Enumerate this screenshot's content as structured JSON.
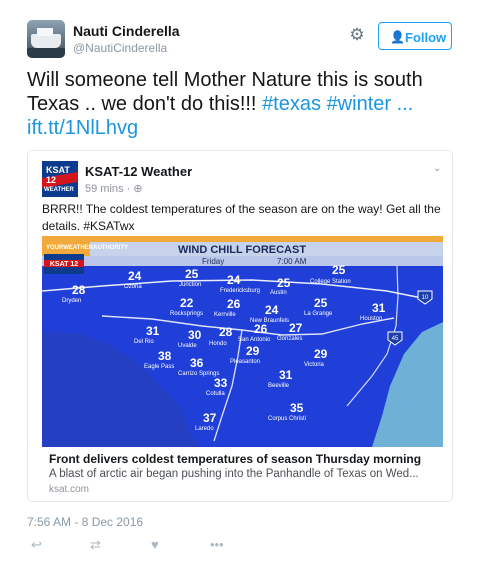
{
  "user": {
    "display_name": "Nauti Cinderella",
    "handle": "@NautiCinderella",
    "follow_label": "Follow"
  },
  "tweet": {
    "text_part1": "Will someone tell Mother Nature this is south Texas .. we don't do this!!! ",
    "hashtag1": "#texas",
    "hashtag2": "#winter",
    "ellipsis": " ...",
    "link": "ift.tt/1NlLhvg",
    "timestamp": "7:56 AM - 8 Dec 2016"
  },
  "card": {
    "source_name": "KSAT-12 Weather",
    "source_time": "59 mins · ",
    "logo_top": "KSAT 12",
    "logo_bottom": "WEATHER",
    "post_text": "BRRR!! The coldest temperatures of the season are on the way! Get all the details.  #KSATwx",
    "link_title": "Front delivers coldest temperatures of season Thursday morning",
    "link_desc": "A blast of arctic air began pushing into the Panhandle of Texas on Wed...",
    "link_domain": "ksat.com"
  },
  "map": {
    "brand": "YOURWEATHERAUTHORITY",
    "title": "WIND CHILL FORECAST",
    "day": "Friday",
    "time": "7:00 AM",
    "station_logo": "KSAT 12",
    "readings": [
      {
        "temp": "24",
        "city": "Ozona"
      },
      {
        "temp": "25",
        "city": "Junction"
      },
      {
        "temp": "24",
        "city": "Fredericksburg"
      },
      {
        "temp": "25",
        "city": "Austin"
      },
      {
        "temp": "25",
        "city": "College Station"
      },
      {
        "temp": "28",
        "city": "Dryden"
      },
      {
        "temp": "22",
        "city": "Rocksprings"
      },
      {
        "temp": "26",
        "city": "Kerrville"
      },
      {
        "temp": "24",
        "city": "New Braunfels"
      },
      {
        "temp": "25",
        "city": "La Grange"
      },
      {
        "temp": "31",
        "city": "Houston"
      },
      {
        "temp": "31",
        "city": "Del Rio"
      },
      {
        "temp": "30",
        "city": "Uvalde"
      },
      {
        "temp": "28",
        "city": "Hondo"
      },
      {
        "temp": "26",
        "city": "San Antonio"
      },
      {
        "temp": "27",
        "city": "Gonzales"
      },
      {
        "temp": "38",
        "city": "Eagle Pass"
      },
      {
        "temp": "36",
        "city": "Carrizo Springs"
      },
      {
        "temp": "29",
        "city": "Pleasanton"
      },
      {
        "temp": "29",
        "city": "Victoria"
      },
      {
        "temp": "33",
        "city": "Cotulla"
      },
      {
        "temp": "31",
        "city": "Beeville"
      },
      {
        "temp": "35",
        "city": "Corpus Christi"
      },
      {
        "temp": "37",
        "city": "Laredo"
      }
    ],
    "highway_10": "10",
    "highway_45": "45"
  },
  "colors": {
    "accent": "#1da1f2",
    "link": "#1b95e0",
    "map_land": "#1f3fd8",
    "map_water": "#6fb1d6",
    "map_banner": "#f0a93a"
  },
  "actions": [
    "reply-icon",
    "retweet-icon",
    "like-icon",
    "more-icon"
  ]
}
